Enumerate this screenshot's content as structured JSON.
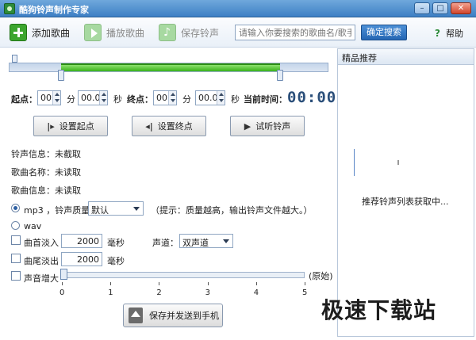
{
  "window": {
    "title": "酷狗铃声制作专家",
    "controls": [
      "–",
      "□",
      "✕"
    ]
  },
  "toolbar": {
    "add_song": "添加歌曲",
    "play_song": "播放歌曲",
    "save_ringtone": "保存铃声",
    "search_placeholder": "请输入你要搜索的歌曲名/歌手",
    "search_button": "确定搜索",
    "help": "帮助"
  },
  "recommend": {
    "header": "精品推荐",
    "loading": "推荐铃声列表获取中..."
  },
  "range": {
    "start_fraction": 0.165,
    "end_fraction": 0.848
  },
  "time_row": {
    "start_label": "起点：",
    "start_min": "00",
    "min_unit": "分",
    "start_sec": "00.0",
    "sec_unit": "秒",
    "end_label": "终点：",
    "end_min": "00",
    "end_sec": "00.0",
    "current_label": "当前时间：",
    "current_time": "00:00"
  },
  "actions": {
    "set_start": "设置起点",
    "set_end": "设置终点",
    "preview": "试听铃声"
  },
  "info": {
    "ringtone": "铃声信息：未截取",
    "song_name": "歌曲名称：未读取",
    "song_info": "歌曲信息：未读取"
  },
  "format": {
    "mp3_label": "mp3 ，铃声质量：",
    "quality": "默认",
    "hint": "（提示：质量越高，输出铃声文件越大。）",
    "wav_label": "wav"
  },
  "effects": {
    "fade_in_label": "曲首淡入",
    "fade_in_value": "2000",
    "fade_out_label": "曲尾淡出",
    "fade_out_value": "2000",
    "ms_unit": "毫秒",
    "channel_label": "声道：",
    "channel_value": "双声道",
    "volume_label": "声音增大",
    "volume_original": "(原始)",
    "volume_value": 0,
    "volume_ticks": [
      "0",
      "1",
      "2",
      "3",
      "4",
      "5"
    ]
  },
  "save_send": "保存并发送到手机",
  "watermark": "极速下载站"
}
